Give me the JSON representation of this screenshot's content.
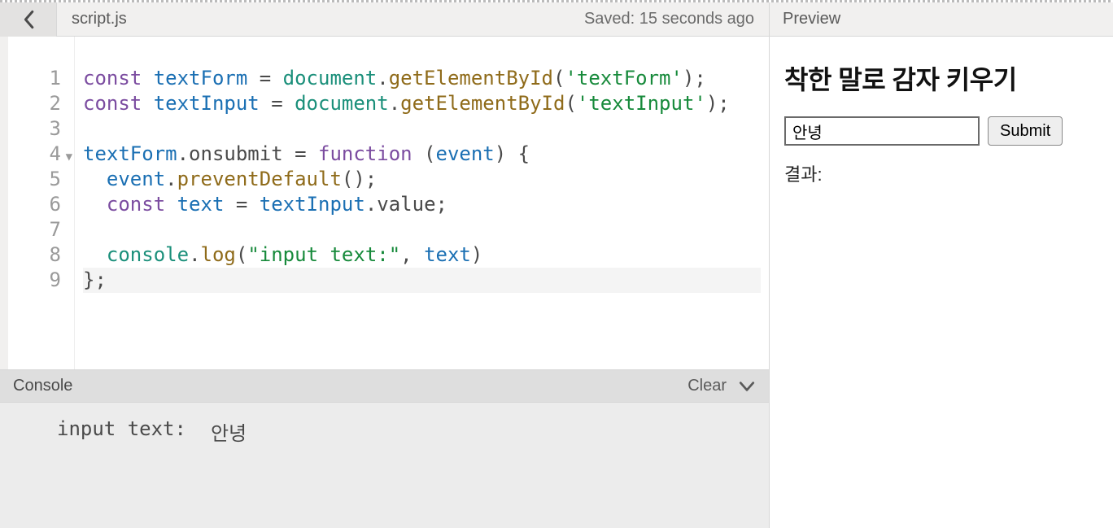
{
  "editor": {
    "filename": "script.js",
    "saved_status": "Saved: 15 seconds ago",
    "gutter": [
      "1",
      "2",
      "3",
      "4",
      "5",
      "6",
      "7",
      "8",
      "9"
    ],
    "fold_line": 4,
    "highlight_line": 9,
    "code": {
      "line1": {
        "kw": "const",
        "var": "textForm",
        "eq": " = ",
        "glob": "document",
        "dot": ".",
        "fn": "getElementById",
        "paren_open": "(",
        "str": "'textForm'",
        "paren_close": ");"
      },
      "line2": {
        "kw": "const",
        "var": "textInput",
        "eq": " = ",
        "glob": "document",
        "dot": ".",
        "fn": "getElementById",
        "paren_open": "(",
        "str": "'textInput'",
        "paren_close": ");"
      },
      "line3": "",
      "line4": {
        "var": "textForm",
        "dot": ".",
        "prop": "onsubmit",
        "eq": " = ",
        "kw": "function",
        "sp": " (",
        "arg": "event",
        "close": ") {"
      },
      "line5": {
        "ind": "  ",
        "var": "event",
        "dot": ".",
        "fn": "preventDefault",
        "rest": "();"
      },
      "line6": {
        "ind": "  ",
        "kw": "const",
        "sp": " ",
        "var": "text",
        "eq": " = ",
        "var2": "textInput",
        "dot": ".",
        "prop": "value",
        "semi": ";"
      },
      "line7": "",
      "line8": {
        "ind": "  ",
        "glob": "console",
        "dot": ".",
        "fn": "log",
        "paren_open": "(",
        "str": "\"input text:\"",
        "comma": ", ",
        "var": "text",
        "paren_close": ")"
      },
      "line9": "};"
    }
  },
  "console": {
    "title": "Console",
    "clear_label": "Clear",
    "output_prefix": "input text:",
    "output_value": "안녕"
  },
  "preview": {
    "title": "Preview",
    "heading": "착한 말로 감자 키우기",
    "input_value": "안녕",
    "submit_label": "Submit",
    "result_label": "결과:"
  }
}
